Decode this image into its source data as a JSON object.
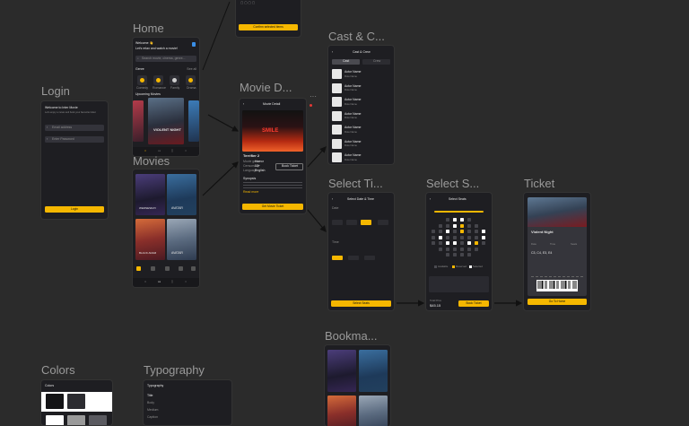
{
  "canvas": {
    "background": "#2b2b2b",
    "accent": "#f5b700"
  },
  "frames": {
    "home": "Home",
    "login": "Login",
    "movies": "Movies",
    "movie_detail": "Movie D...",
    "cast": "Cast & C...",
    "select_time": "Select Ti...",
    "select_seat": "Select S...",
    "ticket": "Ticket",
    "bookmark": "Bookma...",
    "colors": "Colors",
    "typography": "Typography"
  },
  "top_partial": {
    "button": "Confirm selected items"
  },
  "home": {
    "greeting": "Welcome 👋",
    "subtitle": "Let's relax and watch a movie!",
    "search": "Search movie, cinema, genre...",
    "section_genre": "Genre",
    "see_all": "See all",
    "categories": [
      "Comedy",
      "Romance",
      "Family",
      "Drama"
    ],
    "section_upcoming": "Upcoming Movies",
    "poster_title": "VIOLENT NIGHT"
  },
  "login": {
    "title": "Welcome to Inter Movie",
    "subtitle": "Let's enjoy a movie and book your favourite ticket",
    "email": "Email address",
    "password": "Enter Password",
    "button": "Login"
  },
  "movies": {
    "posters": [
      "WEDNESDAY",
      "AVATAR",
      "BLACK ADAM",
      "AVATAR"
    ]
  },
  "movie_detail": {
    "header": "Movie Detail",
    "poster_title": "SMILE",
    "title": "Terrifier 2",
    "meta": [
      "Movie genre",
      "Censorship",
      "Language"
    ],
    "meta_values": [
      "Horror",
      "13+",
      "English"
    ],
    "button_small": "Book Ticket",
    "section": "Synopsis",
    "more": "Read more",
    "button": "Get Movie Ticket"
  },
  "cast": {
    "header": "Cast & Crew",
    "tabs": [
      "Cast",
      "Crew"
    ],
    "rows": [
      {
        "name": "Actor Name",
        "role": "Role Name"
      },
      {
        "name": "Actor Name",
        "role": "Role Name"
      },
      {
        "name": "Actor Name",
        "role": "Role Name"
      },
      {
        "name": "Actor Name",
        "role": "Role Name"
      },
      {
        "name": "Actor Name",
        "role": "Role Name"
      },
      {
        "name": "Actor Name",
        "role": "Role Name"
      },
      {
        "name": "Actor Name",
        "role": "Role Name"
      }
    ]
  },
  "select_time": {
    "header": "Select Date & Time",
    "section_date": "Date",
    "section_time": "Time",
    "button": "Select Seats"
  },
  "select_seat": {
    "header": "Select Seats",
    "legend": [
      "Available",
      "Reserved",
      "Selected"
    ],
    "price": "$45.15",
    "total_label": "Total Price",
    "button": "Book Ticket"
  },
  "ticket": {
    "title": "Violent Night",
    "fields": [
      "Date",
      "Time",
      "Seats"
    ],
    "seats": "C3, C4, E3, E4",
    "button": "Go To Home"
  },
  "colors": {
    "title": "Colors"
  },
  "typography": {
    "title": "Typography",
    "styles": [
      "Title",
      "Body",
      "Medium",
      "Caption"
    ]
  }
}
